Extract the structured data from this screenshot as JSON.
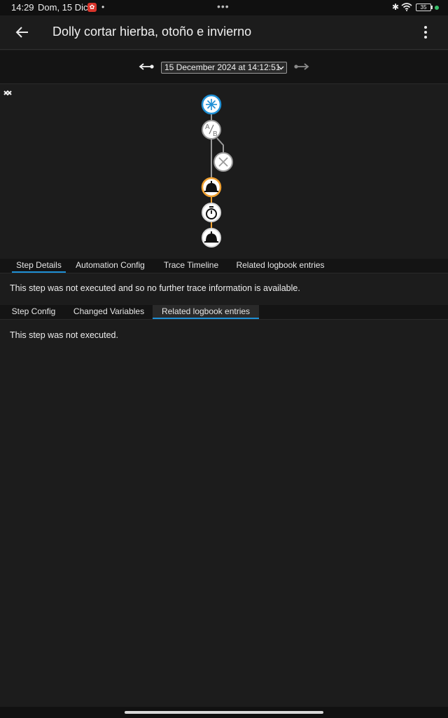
{
  "status_bar": {
    "time": "14:29",
    "date": "Dom, 15 Dic",
    "notification_dots": "•",
    "overflow_dots": "•••",
    "battery": "35"
  },
  "app_bar": {
    "title": "Dolly cortar hierba, otoño e invierno"
  },
  "trace_nav": {
    "selected_trace": "15 December 2024 at 14:12:51"
  },
  "graph": {
    "nodes": [
      {
        "name": "trigger-node",
        "icon": "asterisk-icon",
        "state": "active-blue"
      },
      {
        "name": "condition-node",
        "icon": "ab-split-icon",
        "state": "gray"
      },
      {
        "name": "stop-node",
        "icon": "close-icon",
        "state": "gray"
      },
      {
        "name": "service-node-1",
        "icon": "bell-icon",
        "state": "selected-orange"
      },
      {
        "name": "delay-node",
        "icon": "timer-icon",
        "state": "white"
      },
      {
        "name": "service-node-2",
        "icon": "bell-icon",
        "state": "white"
      }
    ],
    "colors": {
      "trigger": "#1e90d6",
      "path": "#f0a030",
      "gray": "#9a9a9a"
    }
  },
  "tabs_primary": {
    "items": [
      "Step Details",
      "Automation Config",
      "Trace Timeline",
      "Related logbook entries"
    ],
    "active": "Step Details"
  },
  "step_details": {
    "message": "This step was not executed and so no further trace information is available."
  },
  "tabs_secondary": {
    "items": [
      "Step Config",
      "Changed Variables",
      "Related logbook entries"
    ],
    "active": "Related logbook entries"
  },
  "logbook": {
    "message": "This step was not executed."
  }
}
